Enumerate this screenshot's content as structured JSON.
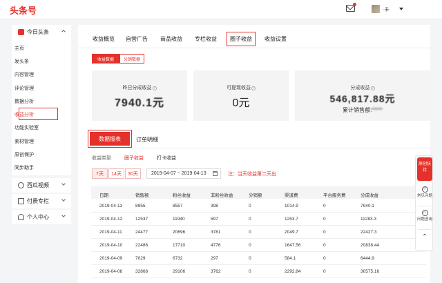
{
  "app": {
    "logo": "头条号",
    "username": "·丰·"
  },
  "sidebar": {
    "section_label": "今日头条",
    "items": [
      "主页",
      "发头条",
      "内容管理",
      "评论管理",
      "数据分析",
      "收益分析",
      "功能实验室",
      "素材管理",
      "原创保护",
      "同步助手"
    ],
    "active_index": 5,
    "groups": [
      "西瓜视频",
      "付费专栏",
      "个人中心"
    ]
  },
  "tabs": {
    "items": [
      "收益概览",
      "自营广告",
      "商品收益",
      "专栏收益",
      "圈子收益",
      "收益设置"
    ],
    "active_index": 4
  },
  "segment": {
    "on": "收益数据",
    "off": "分销数据"
  },
  "cards": [
    {
      "label": "昨日分成收益",
      "value": "7940.1元"
    },
    {
      "label": "可提现收益",
      "value": "0元"
    },
    {
      "label": "分成收益",
      "value": "546,817.88元",
      "sub_label": "累计销售额:",
      "sub_value": "*****"
    }
  ],
  "subtabs": {
    "active": "数据报表",
    "other": "订单明细"
  },
  "filter": {
    "label": "收益类型",
    "options": [
      "圈子收益",
      "打卡收益"
    ],
    "active_index": 0
  },
  "range": {
    "buttons": [
      "7天",
      "14天",
      "30天"
    ],
    "active_index": 0,
    "date_range": "2019-04-07  ~  2019-04-13",
    "note": "注：当天收益第二天出"
  },
  "table": {
    "columns": [
      "日期",
      "销售额",
      "粉丝收益",
      "非粉丝收益",
      "分销额",
      "渠道费",
      "平台服务费",
      "分成收益"
    ],
    "rows": [
      [
        "2019-04-13",
        "8955",
        "8557",
        "398",
        "0",
        "1014.9",
        "0",
        "7940.1"
      ],
      [
        "2019-04-12",
        "12537",
        "11940",
        "597",
        "0",
        "1253.7",
        "0",
        "11283.3"
      ],
      [
        "2019-04-11",
        "24477",
        "20696",
        "3781",
        "0",
        "2049.7",
        "0",
        "22427.3"
      ],
      [
        "2019-04-10",
        "22486",
        "17710",
        "4776",
        "0",
        "1647.56",
        "0",
        "20838.44"
      ],
      [
        "2019-04-09",
        "7029",
        "6732",
        "297",
        "0",
        "584.1",
        "0",
        "6444.9"
      ],
      [
        "2019-04-08",
        "32868",
        "29106",
        "3762",
        "0",
        "2292.84",
        "0",
        "30575.16"
      ]
    ]
  },
  "float": {
    "top": "原创扶持",
    "items": [
      "常见问题",
      "问题咨询"
    ]
  },
  "colors": {
    "accent": "#e4312b",
    "panel": "#ffffff",
    "background": "#f4f5f6"
  },
  "icons": [
    "mail-icon",
    "avatar",
    "caret-down-icon",
    "question-icon",
    "calendar-icon",
    "help-icon",
    "headset-icon",
    "arrow-up-icon"
  ]
}
